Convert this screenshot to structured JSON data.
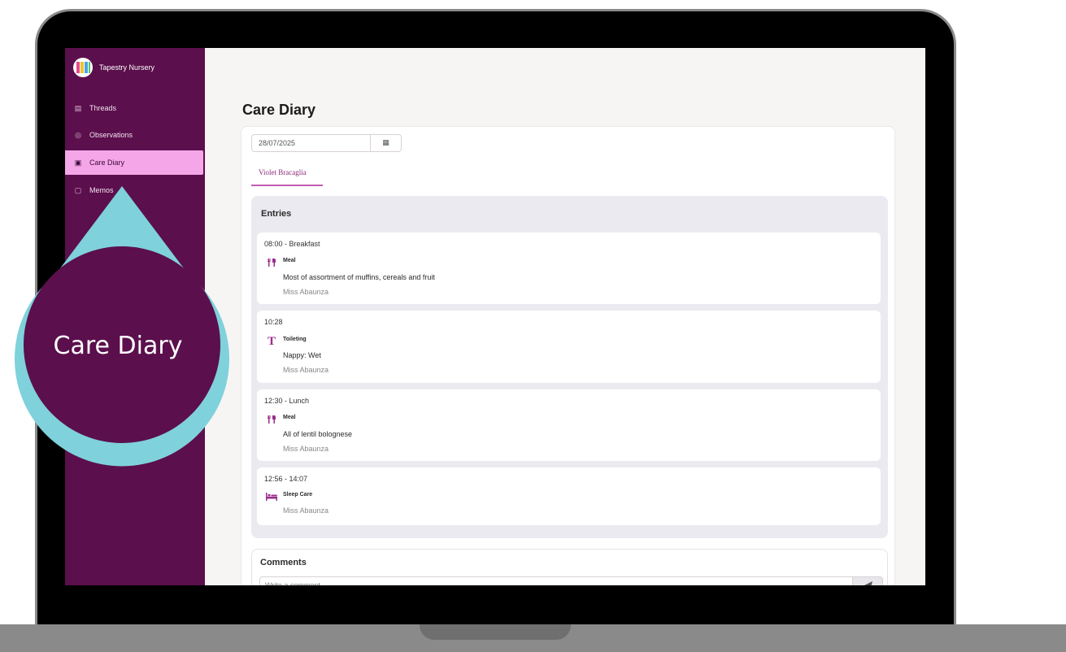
{
  "brand": {
    "name": "Tapestry Nursery"
  },
  "sidebar": {
    "items": [
      {
        "label": "Threads",
        "icon": "threads-icon"
      },
      {
        "label": "Observations",
        "icon": "observations-icon"
      },
      {
        "label": "Care Diary",
        "icon": "care-diary-icon",
        "active": true
      },
      {
        "label": "Memos",
        "icon": "memos-icon"
      }
    ]
  },
  "page": {
    "title": "Care Diary"
  },
  "date_picker": {
    "value": "28/07/2025",
    "icon": "calendar-icon"
  },
  "child_tab": {
    "label": "Violet Bracaglia"
  },
  "entries": {
    "title": "Entries",
    "items": [
      {
        "time": "08:00 - Breakfast",
        "type": "Meal",
        "icon": "meal-icon",
        "description": "Most of assortment of muffins, cereals and fruit",
        "by": "Miss Abaunza"
      },
      {
        "time": "10:28",
        "type": "Toileting",
        "icon": "toileting-icon",
        "description": "Nappy: Wet",
        "by": "Miss Abaunza"
      },
      {
        "time": "12:30 - Lunch",
        "type": "Meal",
        "icon": "meal-icon",
        "description": "All of lentil bolognese",
        "by": "Miss Abaunza"
      },
      {
        "time": "12:56 - 14:07",
        "type": "Sleep Care",
        "icon": "sleep-icon",
        "description": "",
        "by": "Miss Abaunza"
      }
    ]
  },
  "comments": {
    "title": "Comments",
    "placeholder": "Write a comment",
    "send_icon": "send-icon"
  },
  "callout": {
    "label": "Care Diary"
  },
  "colors": {
    "sidebar": "#5b0f4c",
    "active": "#f4a6e8",
    "accent": "#9b2d8c",
    "callout_ring": "#7fd1dc"
  }
}
